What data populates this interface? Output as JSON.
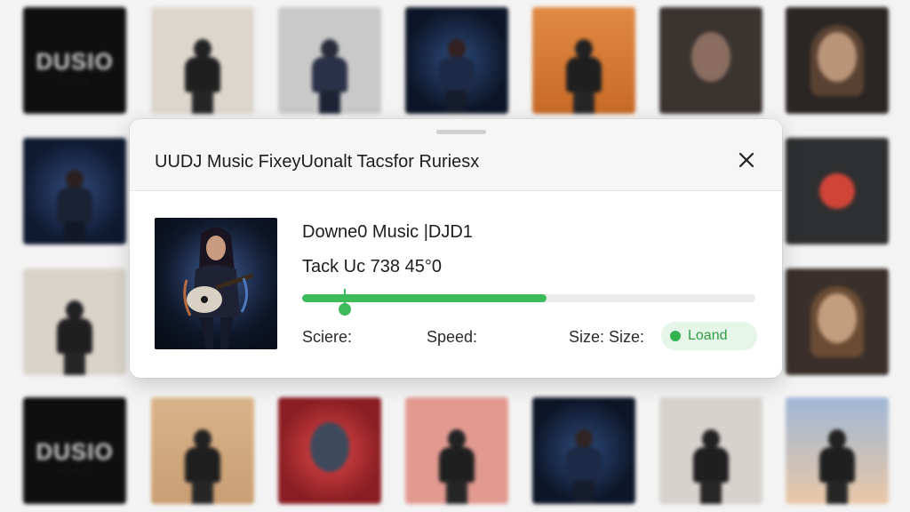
{
  "dialog": {
    "title": "UUDJ Music FixeyUonalt Tacsfor Ruriesx",
    "close_icon": "close-icon"
  },
  "track": {
    "name": "Downe0 Music |DJD1",
    "number_line": "Tack Uc 738 45°0",
    "progress_fraction": 0.54
  },
  "stats": {
    "score_label": "Sciere:",
    "speed_label": "Speed:",
    "size_label": "Size: Size:"
  },
  "status": {
    "label": "Loand",
    "color": "#33b24f"
  },
  "background": {
    "logo_text": "DUSIO",
    "logo_text_bottom": "DUSIO",
    "colors": {
      "accent": "#3dba5a"
    }
  }
}
